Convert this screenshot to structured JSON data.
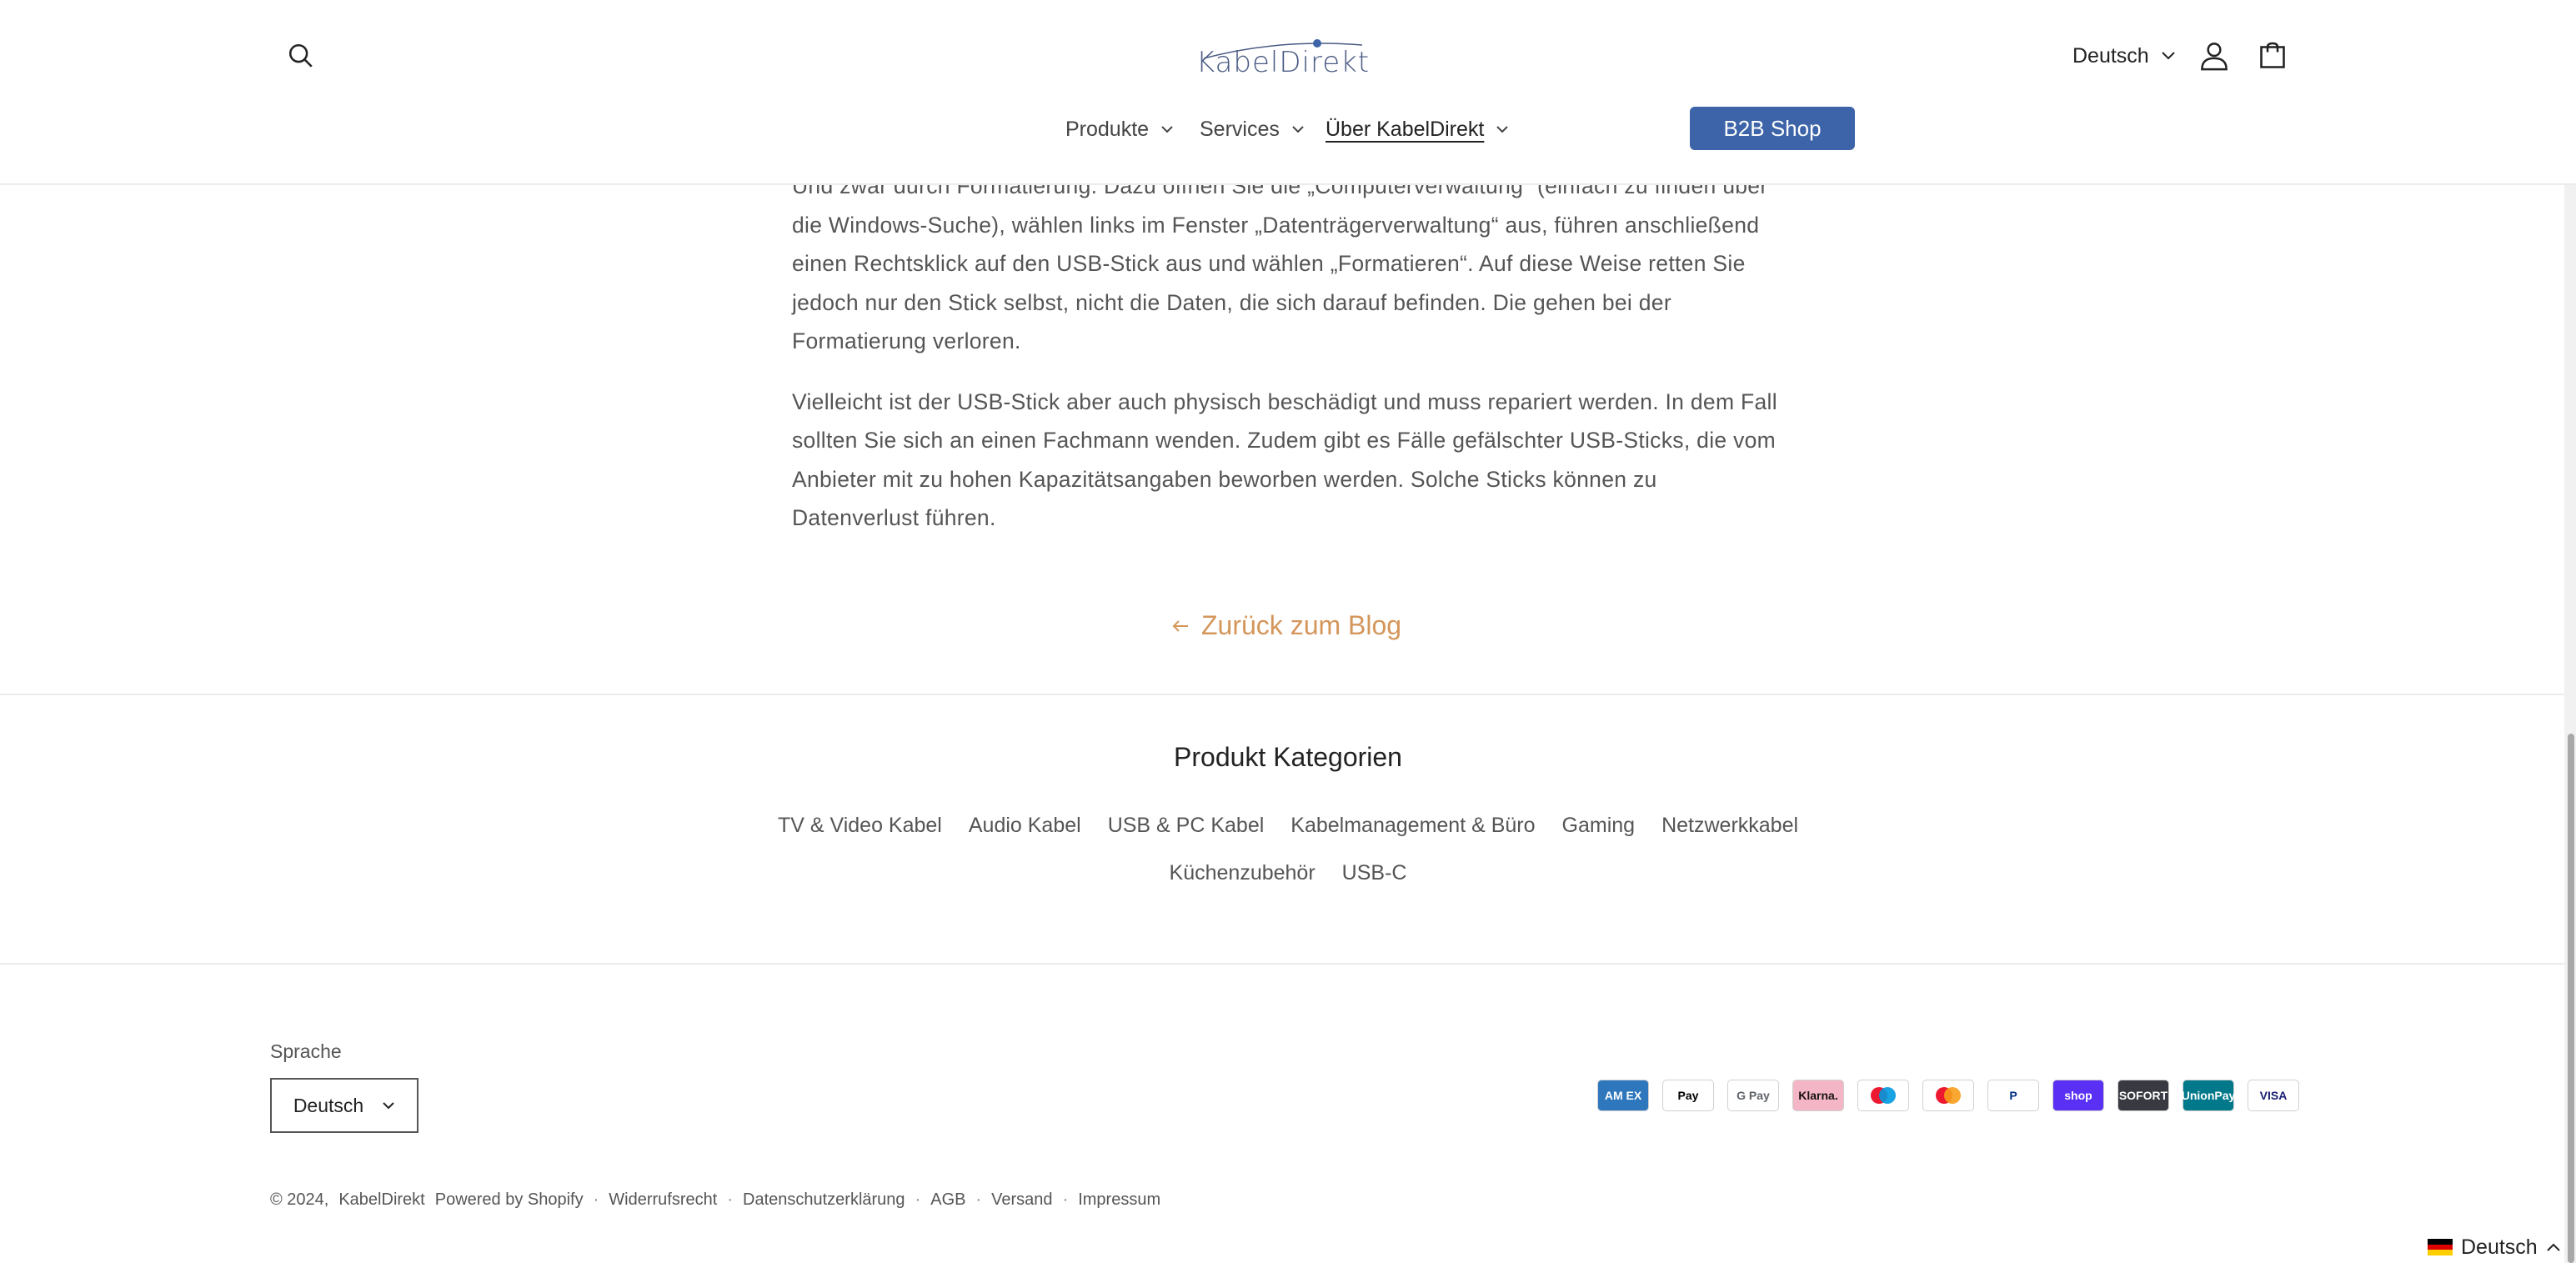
{
  "header": {
    "logo_text": "KabelDirekt",
    "language": "Deutsch",
    "nav": [
      {
        "label": "Produkte"
      },
      {
        "label": "Services"
      },
      {
        "label": "Über KabelDirekt"
      }
    ],
    "b2b_label": "B2B Shop"
  },
  "article": {
    "paragraphs": [
      "Und zwar durch Formatierung. Dazu öffnen Sie die „Computerverwaltung“ (einfach zu finden über die Windows-Suche), wählen links im Fenster „Datenträgerverwaltung“ aus, führen anschließend einen Rechtsklick auf den USB-Stick aus und wählen „Formatieren“. Auf diese Weise retten Sie jedoch nur den Stick selbst, nicht die Daten, die sich darauf befinden. Die gehen bei der Formatierung verloren.",
      "Vielleicht ist der USB-Stick aber auch physisch beschädigt und muss repariert werden. In dem Fall sollten Sie sich an einen Fachmann wenden. Zudem gibt es Fälle gefälschter USB-Sticks, die vom Anbieter mit zu hohen Kapazitätsangaben beworben werden. Solche Sticks können zu Datenverlust führen."
    ],
    "back_link": "Zurück zum Blog"
  },
  "categories": {
    "title": "Produkt Kategorien",
    "row1": [
      "TV & Video Kabel",
      "Audio Kabel",
      "USB & PC Kabel",
      "Kabelmanagement & Büro",
      "Gaming",
      "Netzwerkkabel"
    ],
    "row2": [
      "Küchenzubehör",
      "USB-C"
    ]
  },
  "footer": {
    "language_label": "Sprache",
    "language_value": "Deutsch",
    "payments": [
      {
        "name": "American Express",
        "label": "AM EX",
        "bg": "#2e77bc",
        "fg": "#ffffff"
      },
      {
        "name": "Apple Pay",
        "label": " Pay",
        "bg": "#ffffff",
        "fg": "#000000"
      },
      {
        "name": "Google Pay",
        "label": "G Pay",
        "bg": "#ffffff",
        "fg": "#5f6368"
      },
      {
        "name": "Klarna",
        "label": "Klarna.",
        "bg": "#f4b6c7",
        "fg": "#17120f"
      },
      {
        "name": "Maestro",
        "label": "",
        "bg": "#ffffff",
        "fg": "#000000"
      },
      {
        "name": "Mastercard",
        "label": "",
        "bg": "#ffffff",
        "fg": "#000000"
      },
      {
        "name": "PayPal",
        "label": "P",
        "bg": "#ffffff",
        "fg": "#003087"
      },
      {
        "name": "Shop Pay",
        "label": "shop",
        "bg": "#5a31f4",
        "fg": "#ffffff"
      },
      {
        "name": "Sofort",
        "label": "SOFORT",
        "bg": "#393a41",
        "fg": "#ffffff"
      },
      {
        "name": "UnionPay",
        "label": "UnionPay",
        "bg": "#01798a",
        "fg": "#ffffff"
      },
      {
        "name": "Visa",
        "label": "VISA",
        "bg": "#ffffff",
        "fg": "#1a1f71"
      }
    ],
    "copyright": "© 2024,",
    "brand_link": "KabelDirekt",
    "powered": "Powered by Shopify",
    "links": [
      "Widerrufsrecht",
      "Datenschutzerklärung",
      "AGB",
      "Versand",
      "Impressum"
    ],
    "separator": "·"
  },
  "translate_widget": {
    "label": "Deutsch"
  },
  "colors": {
    "accent": "#3d64a8",
    "link": "#d4965b"
  }
}
